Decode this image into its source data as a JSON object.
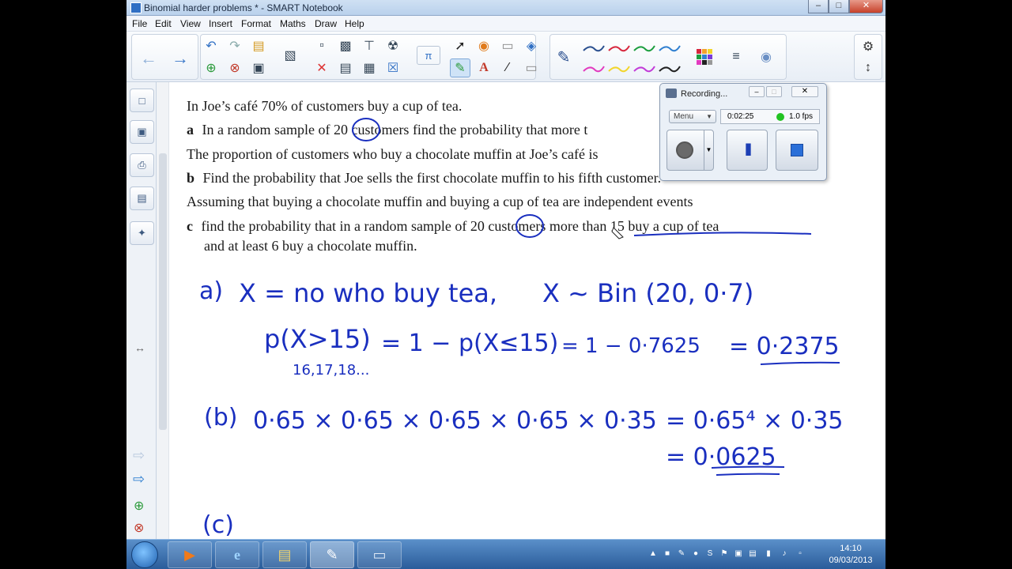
{
  "window": {
    "title": "Binomial harder problems * - SMART Notebook",
    "minimize": "–",
    "maximize": "□",
    "close": "✕"
  },
  "menu": [
    "File",
    "Edit",
    "View",
    "Insert",
    "Format",
    "Maths",
    "Draw",
    "Help"
  ],
  "toolbar": {
    "back_icon": "arrow-left-icon",
    "forward_icon": "arrow-right-icon",
    "pi_label": "π",
    "text_tool_label": "A",
    "pen_colors": [
      "#2a4f8f",
      "#d7263d",
      "#1b9e3e",
      "#2f7fd0",
      "#e23bbf",
      "#f2d52b",
      "#c23bd8",
      "#222222"
    ]
  },
  "question": {
    "intro": "In Joe’s café 70% of customers buy a cup of tea.",
    "a_label": "a",
    "a_text_1": "In a random sample of ",
    "a_n": "20",
    "a_text_2": " customers find the probability that more t",
    "line3": "The proportion of customers who buy a chocolate muffin at Joe’s café is",
    "b_label": "b",
    "b_text": "Find the probability that Joe sells the first chocolate muffin to his fifth customer.",
    "line5": "Assuming that buying a chocolate muffin and buying a cup of tea are independent events",
    "c_label": "c",
    "c_text_1": "find the probability that in a random sample of ",
    "c_n": "20",
    "c_text_2": " customers more than 15 buy a cup of tea",
    "c_text_3": "and at least 6 buy a chocolate muffin."
  },
  "handwriting": {
    "a_label": "a)",
    "a_def": "X = no who buy tea,",
    "a_dist": "X ~ Bin (20, 0·7)",
    "a_p1": "p(X>15)",
    "a_eq1": "= 1 − p(X≤15)",
    "a_eq2": "= 1 − 0·7625",
    "a_eq3": "= 0·2375",
    "a_list": "16,17,18...",
    "b_label": "(b)",
    "b_expr": "0·65 × 0·65 × 0·65 × 0·65 × 0·35",
    "b_eq1": "= 0·65⁴ × 0·35",
    "b_eq2": "= 0·0625",
    "c_label": "(c)"
  },
  "recorder": {
    "title": "Recording...",
    "menu_label": "Menu",
    "elapsed": "0:02:25",
    "fps": "1.0 fps",
    "status_color": "#22c322"
  },
  "taskbar": {
    "clock_time": "14:10",
    "clock_date": "09/03/2013",
    "apps": [
      "media-player-icon",
      "internet-explorer-icon",
      "file-explorer-icon",
      "smart-notebook-icon",
      "smart-tools-icon"
    ]
  }
}
